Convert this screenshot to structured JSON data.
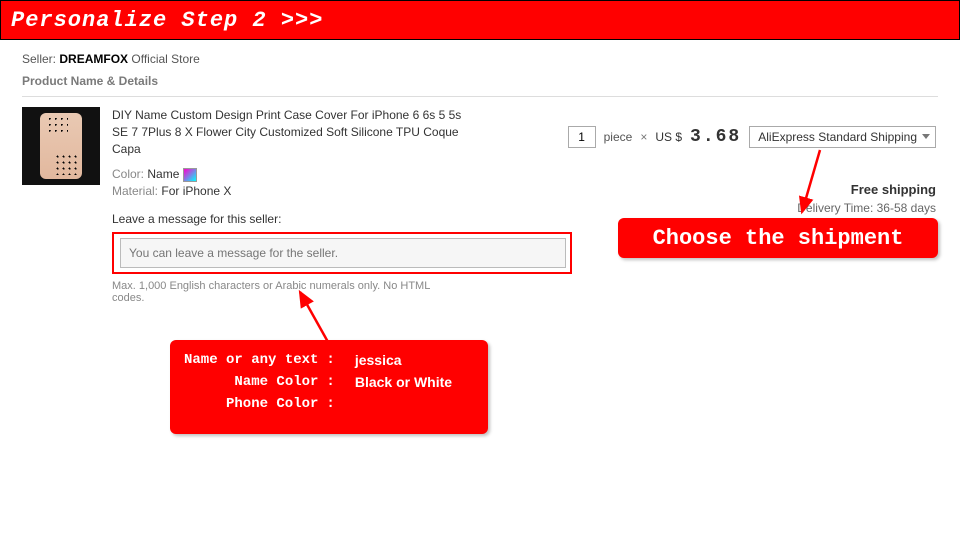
{
  "hero": {
    "title": "Personalize Step 2 >>>"
  },
  "seller": {
    "label": "Seller:",
    "name": "DREAMFOX",
    "suffix": "Official Store"
  },
  "section": {
    "heading": "Product Name & Details"
  },
  "product": {
    "title": "DIY Name Custom Design Print Case Cover For iPhone 6 6s 5 5s SE 7 7Plus 8 X Flower City Customized Soft Silicone TPU Coque Capa",
    "color_label": "Color:",
    "color_value": "Name",
    "material_label": "Material:",
    "material_value": "For iPhone X"
  },
  "message": {
    "label": "Leave a message for this seller:",
    "placeholder": "You can leave a message for the seller.",
    "hint": "Max. 1,000 English characters or Arabic numerals only. No HTML codes."
  },
  "order": {
    "qty": "1",
    "unit": "piece",
    "times": "×",
    "currency": "US $",
    "price": "3.68",
    "shipping_option": "AliExpress Standard Shipping",
    "free_shipping": "Free shipping",
    "delivery_label": "Delivery Time:",
    "delivery_value": "36-58 days"
  },
  "callouts": {
    "shipment": "Choose the shipment",
    "form": {
      "row1_label": "Name or any text",
      "row1_value": "jessica",
      "row2_label": "Name Color",
      "row2_value": "Black or White",
      "row3_label": "Phone Color",
      "row3_value": "",
      "colon": ":"
    }
  }
}
